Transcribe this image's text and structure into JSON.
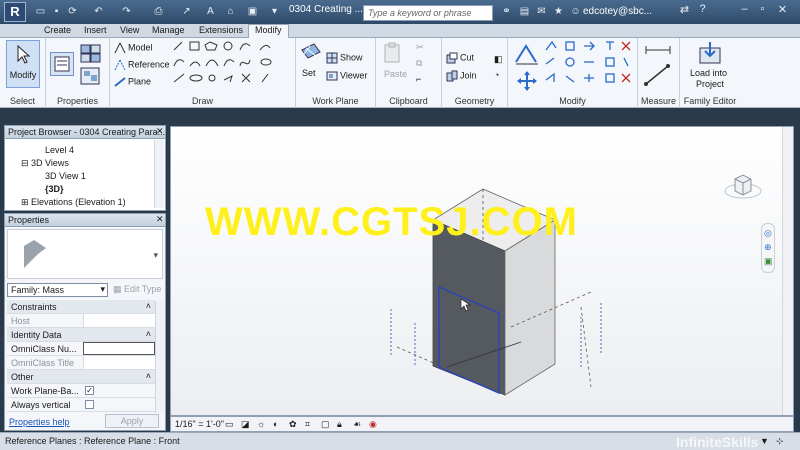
{
  "window": {
    "app_menu": "R",
    "doc_title": "0304 Creating ...",
    "search_placeholder": "Type a keyword or phrase",
    "user": "edcotey@sbc..."
  },
  "tabs": [
    {
      "label": "Create"
    },
    {
      "label": "Insert"
    },
    {
      "label": "View"
    },
    {
      "label": "Manage"
    },
    {
      "label": "Extensions"
    },
    {
      "label": "Modify"
    }
  ],
  "ribbon": {
    "select": {
      "button": "Modify",
      "title": "Select"
    },
    "properties": {
      "title": "Properties"
    },
    "draw": {
      "model": "Model",
      "reference": "Reference",
      "plane": "Plane",
      "title": "Draw"
    },
    "work_plane": {
      "set": "Set",
      "show": "Show",
      "viewer": "Viewer",
      "title": "Work Plane"
    },
    "clipboard": {
      "paste": "Paste",
      "title": "Clipboard"
    },
    "geometry": {
      "cut": "Cut",
      "join": "Join",
      "title": "Geometry"
    },
    "modify": {
      "title": "Modify"
    },
    "measure": {
      "title": "Measure"
    },
    "family_editor": {
      "load_line1": "Load into",
      "load_line2": "Project",
      "title": "Family Editor"
    }
  },
  "project_browser": {
    "title": "Project Browser - 0304 Creating Para...",
    "items": [
      "Level 4",
      "3D Views",
      "3D View 1",
      "{3D}",
      "Elevations (Elevation 1)"
    ]
  },
  "properties_palette": {
    "title": "Properties",
    "family": "Family: Mass",
    "edit_type": "Edit Type",
    "groups": {
      "constraints": "Constraints",
      "identity": "Identity Data",
      "other": "Other"
    },
    "rows": {
      "host": "Host",
      "omniclass_number": "OmniClass Nu...",
      "omniclass_title": "OmniClass Title",
      "work_plane_based": "Work Plane-Ba...",
      "always_vertical": "Always vertical"
    },
    "work_plane_based_checked": true,
    "always_vertical_checked": false,
    "help_link": "Properties help",
    "apply": "Apply"
  },
  "view": {
    "scale": "1/16\" = 1'-0\"",
    "watermark": "WWW.CGTSJ.COM"
  },
  "status": {
    "text": "Reference Planes : Reference Plane : Front",
    "brand": "InfiniteSkills"
  }
}
